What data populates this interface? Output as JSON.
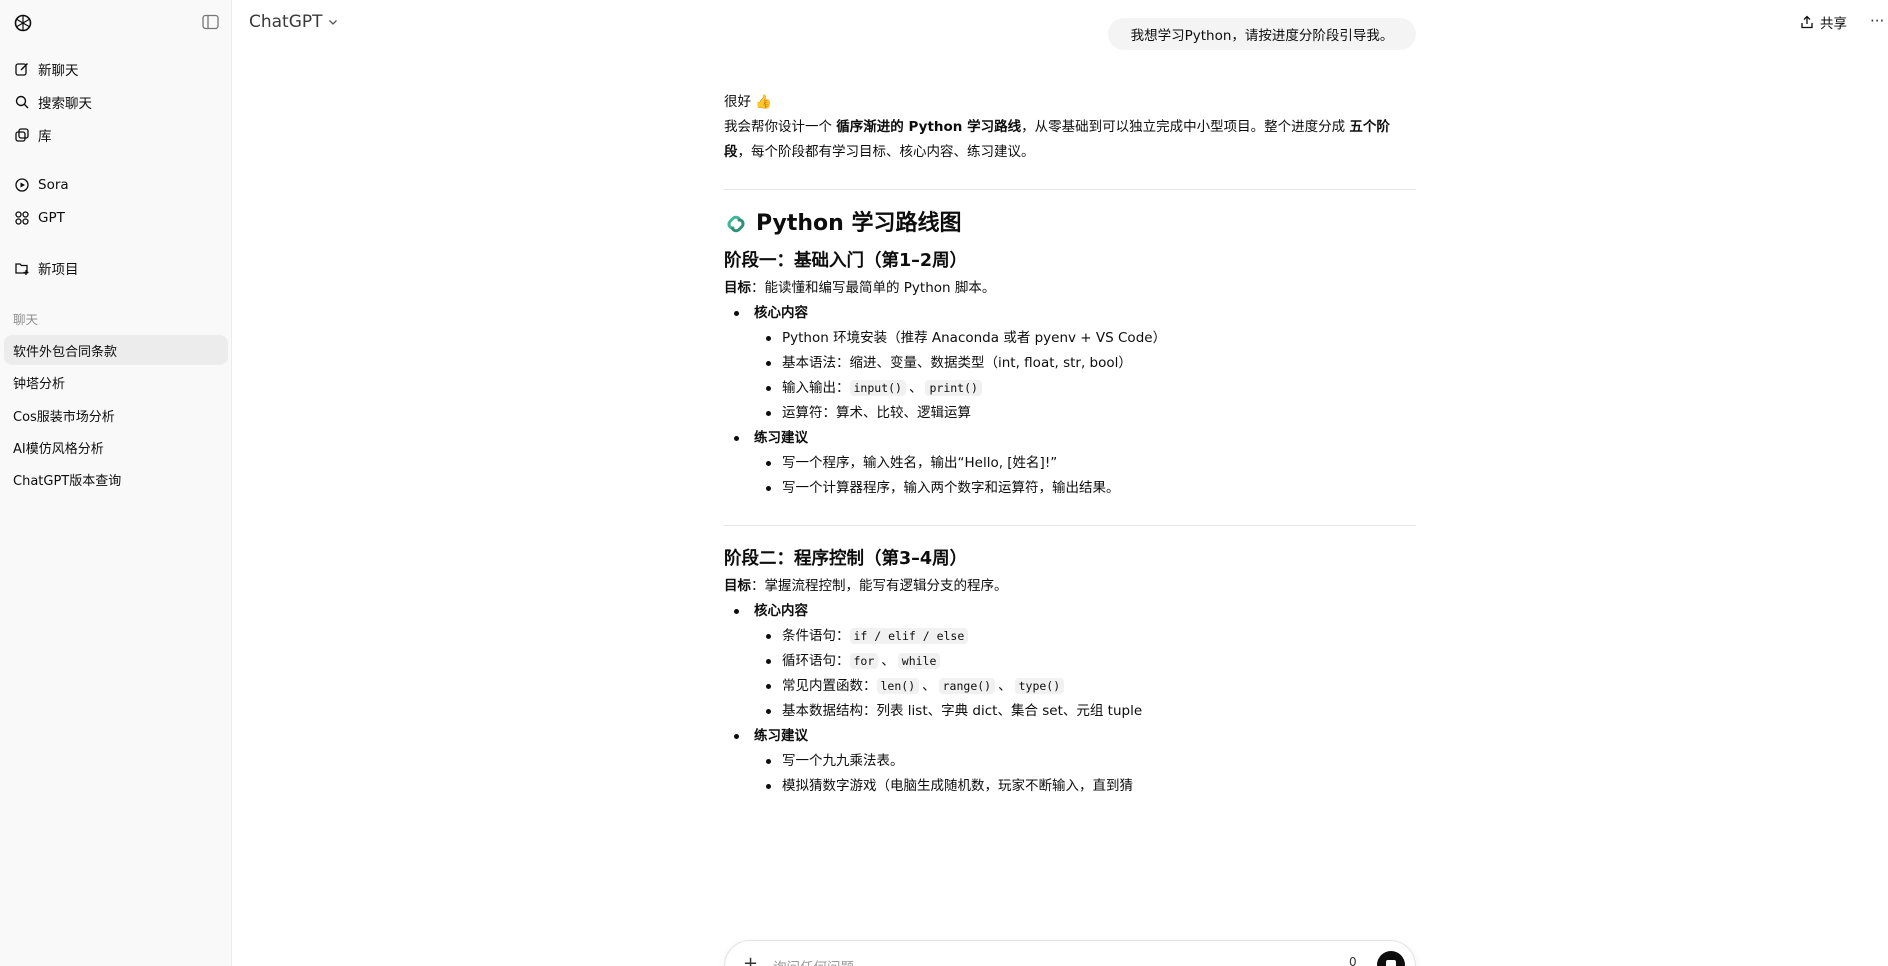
{
  "app": {
    "model_label": "ChatGPT",
    "share_label": "共享",
    "more_label": "···"
  },
  "sidebar": {
    "new_chat": "新聊天",
    "search_chats": "搜索聊天",
    "library": "库",
    "sora": "Sora",
    "gpt": "GPT",
    "new_project": "新项目",
    "section_label": "聊天",
    "chats": [
      "软件外包合同条款",
      "钟塔分析",
      "Cos服装市场分析",
      "AI模仿风格分析",
      "ChatGPT版本查询"
    ]
  },
  "user_message": "我想学习Python，请按进度分阶段引导我。",
  "assistant": {
    "greeting": "很好 👍",
    "intro_1": "我会帮你设计一个 ",
    "intro_bold_1": "循序渐进的 Python 学习路线",
    "intro_2": "，从零基础到可以独立完成中小型项目。整个进度分成 ",
    "intro_bold_2": "五个阶段",
    "intro_3": "，每个阶段都有学习目标、核心内容、练习建议。",
    "roadmap_title": "Python 学习路线图",
    "stage1": {
      "title": "阶段一：基础入门（第1–2周）",
      "goal_label": "目标",
      "goal_text": "：能读懂和编写最简单的 Python 脚本。",
      "core_label": "核心内容",
      "core_1": "Python 环境安装（推荐 Anaconda 或者 pyenv + VS Code）",
      "core_2": "基本语法：缩进、变量、数据类型（int, float, str, bool）",
      "core_3_prefix": "输入输出：",
      "core_3_code_1": "input()",
      "core_3_sep": "、",
      "core_3_code_2": "print()",
      "core_4": "运算符：算术、比较、逻辑运算",
      "practice_label": "练习建议",
      "practice_1": "写一个程序，输入姓名，输出“Hello, [姓名]!”",
      "practice_2": "写一个计算器程序，输入两个数字和运算符，输出结果。"
    },
    "stage2": {
      "title": "阶段二：程序控制（第3–4周）",
      "goal_label": "目标",
      "goal_text": "：掌握流程控制，能写有逻辑分支的程序。",
      "core_label": "核心内容",
      "core_1_prefix": "条件语句：",
      "core_1_code": "if / elif / else",
      "core_2_prefix": "循环语句：",
      "core_2_code_1": "for",
      "core_2_sep": "、",
      "core_2_code_2": "while",
      "core_3_prefix": "常见内置函数：",
      "core_3_code_1": "len()",
      "core_3_sep_1": "、",
      "core_3_code_2": "range()",
      "core_3_sep_2": "、",
      "core_3_code_3": "type()",
      "core_4": "基本数据结构：列表 list、字典 dict、集合 set、元组 tuple",
      "practice_label": "练习建议",
      "practice_1": "写一个九九乘法表。",
      "practice_2": "模拟猜数字游戏（电脑生成随机数，玩家不断输入，直到猜"
    }
  },
  "composer": {
    "placeholder": "询问任何问题",
    "plus": "+",
    "mic": "0"
  }
}
